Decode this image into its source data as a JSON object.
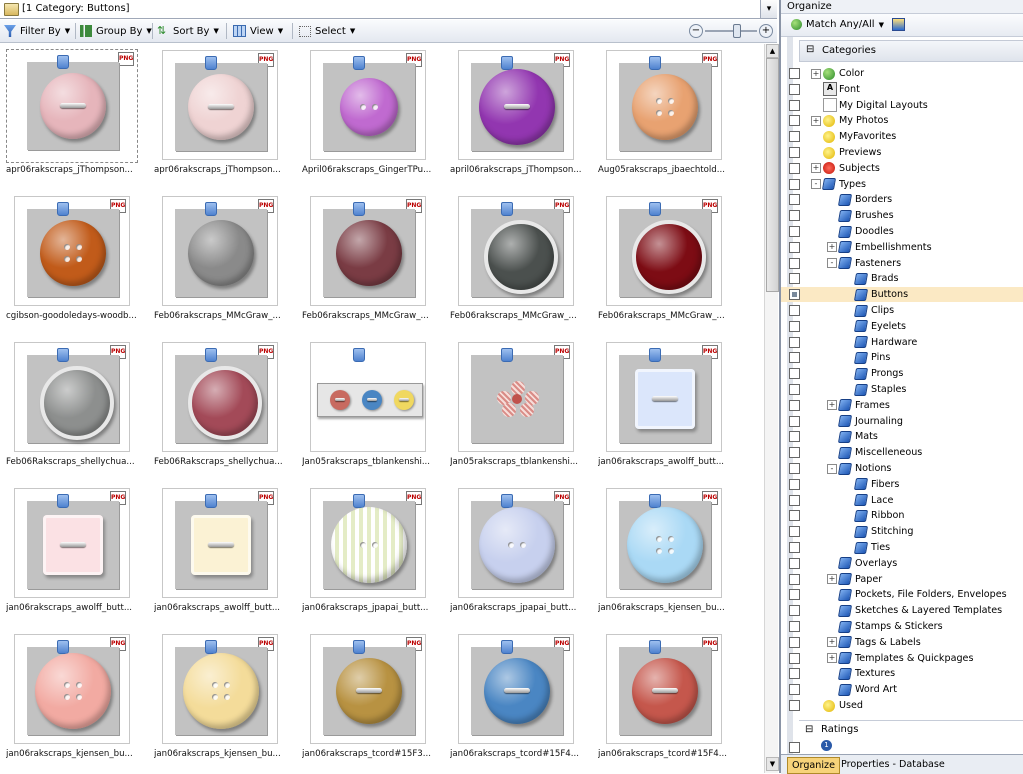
{
  "address": {
    "text": "[1 Category: Buttons]"
  },
  "toolbar": {
    "filter_by": "Filter By",
    "group_by": "Group By",
    "sort_by": "Sort By",
    "view": "View",
    "select": "Select"
  },
  "thumbnails": [
    {
      "caption": "apr06rakscraps_jThompson...",
      "kind": "round",
      "color": "#e6b5bb",
      "holes": "bar",
      "png": true,
      "selected": true
    },
    {
      "caption": "apr06rakscraps_jThompson...",
      "kind": "round",
      "color": "#efd3d3",
      "holes": "bar",
      "png": true
    },
    {
      "caption": "April06rakscraps_GingerTPu...",
      "kind": "round",
      "color": "#c06ad0",
      "holes": "two",
      "png": true,
      "small": true
    },
    {
      "caption": "april06rakscraps_jThompson...",
      "kind": "round",
      "color": "#9236b0",
      "holes": "bar",
      "png": true,
      "big": true
    },
    {
      "caption": "Aug05rakscraps_jbaechtold...",
      "kind": "round",
      "color": "#e8a271",
      "holes": "four",
      "png": true
    },
    {
      "caption": "cgibson-goodoledays-woodb...",
      "kind": "round",
      "color": "#c15b1a",
      "holes": "four",
      "png": true
    },
    {
      "caption": "Feb06rakscraps_MMcGraw_...",
      "kind": "round",
      "color": "#8a8a8a",
      "holes": "none",
      "png": true
    },
    {
      "caption": "Feb06rakscraps_MMcGraw_...",
      "kind": "round",
      "color": "#7a3c44",
      "holes": "none",
      "png": true
    },
    {
      "caption": "Feb06rakscraps_MMcGraw_...",
      "kind": "round",
      "color": "#4b504e",
      "holes": "none",
      "png": true,
      "ring": true
    },
    {
      "caption": "Feb06rakscraps_MMcGraw_...",
      "kind": "round",
      "color": "#7d0c14",
      "holes": "none",
      "png": true,
      "ring": true
    },
    {
      "caption": "Feb06Rakscraps_shellychua...",
      "kind": "round",
      "color": "#8d8f8e",
      "holes": "none",
      "png": true,
      "ring": true
    },
    {
      "caption": "Feb06Rakscraps_shellychua...",
      "kind": "round",
      "color": "#a34a58",
      "holes": "none",
      "png": true,
      "ring": true
    },
    {
      "caption": "Jan05rakscraps_tblankenshi...",
      "kind": "strip",
      "color": "#e8e8e8",
      "holes": "none",
      "png": false
    },
    {
      "caption": "Jan05rakscraps_tblankenshi...",
      "kind": "flower",
      "color": "#d98b86",
      "holes": "none",
      "png": true
    },
    {
      "caption": "jan06rakscraps_awolff_butt...",
      "kind": "square",
      "color": "#dbe6fb",
      "holes": "bar",
      "png": true
    },
    {
      "caption": "jan06rakscraps_awolff_butt...",
      "kind": "square",
      "color": "#fbe1e4",
      "holes": "bar",
      "png": true
    },
    {
      "caption": "jan06rakscraps_awolff_butt...",
      "kind": "square",
      "color": "#fbf2d4",
      "holes": "bar",
      "png": true
    },
    {
      "caption": "jan06rakscraps_jpapai_butt...",
      "kind": "round",
      "color": "#e4ecc6",
      "holes": "two",
      "png": true,
      "big": true,
      "stripes": true
    },
    {
      "caption": "jan06rakscraps_jpapai_butt...",
      "kind": "round",
      "color": "#c7d0ee",
      "holes": "two",
      "png": true,
      "big": true
    },
    {
      "caption": "jan06rakscraps_kjensen_bu...",
      "kind": "round",
      "color": "#aad9f5",
      "holes": "four",
      "png": true,
      "big": true
    },
    {
      "caption": "jan06rakscraps_kjensen_bu...",
      "kind": "round",
      "color": "#f2aaa2",
      "holes": "four",
      "png": true,
      "big": true
    },
    {
      "caption": "jan06rakscraps_kjensen_bu...",
      "kind": "round",
      "color": "#f4dc9a",
      "holes": "four",
      "png": true,
      "big": true
    },
    {
      "caption": "jan06rakscraps_tcord#15F3...",
      "kind": "round",
      "color": "#b89242",
      "holes": "bar",
      "png": true
    },
    {
      "caption": "jan06rakscraps_tcord#15F4...",
      "kind": "round",
      "color": "#4a86c3",
      "holes": "bar",
      "png": true
    },
    {
      "caption": "jan06rakscraps_tcord#15F4...",
      "kind": "round",
      "color": "#c5574c",
      "holes": "bar",
      "png": true
    }
  ],
  "panel": {
    "title": "Organize",
    "match": "Match Any/All",
    "categories_header": "Categories",
    "ratings_header": "Ratings",
    "tab_organize": "Organize",
    "tab_properties": "Properties - Database",
    "rating_value": "1"
  },
  "tree": [
    {
      "label": "Color",
      "level": 0,
      "exp": "+",
      "icon": "globe"
    },
    {
      "label": "Font",
      "level": 0,
      "exp": "",
      "icon": "font"
    },
    {
      "label": "My Digital Layouts",
      "level": 0,
      "exp": "",
      "icon": "doc"
    },
    {
      "label": "My Photos",
      "level": 0,
      "exp": "+",
      "icon": "smile"
    },
    {
      "label": "MyFavorites",
      "level": 0,
      "exp": "",
      "icon": "smile"
    },
    {
      "label": "Previews",
      "level": 0,
      "exp": "",
      "icon": "smile"
    },
    {
      "label": "Subjects",
      "level": 0,
      "exp": "+",
      "icon": "heart"
    },
    {
      "label": "Types",
      "level": 0,
      "exp": "-",
      "icon": "tag"
    },
    {
      "label": "Borders",
      "level": 1,
      "exp": "",
      "icon": "tag"
    },
    {
      "label": "Brushes",
      "level": 1,
      "exp": "",
      "icon": "tag"
    },
    {
      "label": "Doodles",
      "level": 1,
      "exp": "",
      "icon": "tag"
    },
    {
      "label": "Embellishments",
      "level": 1,
      "exp": "+",
      "icon": "tag"
    },
    {
      "label": "Fasteners",
      "level": 1,
      "exp": "-",
      "icon": "tag"
    },
    {
      "label": "Brads",
      "level": 2,
      "exp": "",
      "icon": "tag"
    },
    {
      "label": "Buttons",
      "level": 2,
      "exp": "",
      "icon": "tag",
      "highlight": true
    },
    {
      "label": "Clips",
      "level": 2,
      "exp": "",
      "icon": "tag"
    },
    {
      "label": "Eyelets",
      "level": 2,
      "exp": "",
      "icon": "tag"
    },
    {
      "label": "Hardware",
      "level": 2,
      "exp": "",
      "icon": "tag"
    },
    {
      "label": "Pins",
      "level": 2,
      "exp": "",
      "icon": "tag"
    },
    {
      "label": "Prongs",
      "level": 2,
      "exp": "",
      "icon": "tag"
    },
    {
      "label": "Staples",
      "level": 2,
      "exp": "",
      "icon": "tag"
    },
    {
      "label": "Frames",
      "level": 1,
      "exp": "+",
      "icon": "tag"
    },
    {
      "label": "Journaling",
      "level": 1,
      "exp": "",
      "icon": "tag"
    },
    {
      "label": "Mats",
      "level": 1,
      "exp": "",
      "icon": "tag"
    },
    {
      "label": "Miscelleneous",
      "level": 1,
      "exp": "",
      "icon": "tag"
    },
    {
      "label": "Notions",
      "level": 1,
      "exp": "-",
      "icon": "tag"
    },
    {
      "label": "Fibers",
      "level": 2,
      "exp": "",
      "icon": "tag"
    },
    {
      "label": "Lace",
      "level": 2,
      "exp": "",
      "icon": "tag"
    },
    {
      "label": "Ribbon",
      "level": 2,
      "exp": "",
      "icon": "tag"
    },
    {
      "label": "Stitching",
      "level": 2,
      "exp": "",
      "icon": "tag"
    },
    {
      "label": "Ties",
      "level": 2,
      "exp": "",
      "icon": "tag"
    },
    {
      "label": "Overlays",
      "level": 1,
      "exp": "",
      "icon": "tag"
    },
    {
      "label": "Paper",
      "level": 1,
      "exp": "+",
      "icon": "tag"
    },
    {
      "label": "Pockets, File Folders, Envelopes",
      "level": 1,
      "exp": "",
      "icon": "tag"
    },
    {
      "label": "Sketches & Layered Templates",
      "level": 1,
      "exp": "",
      "icon": "tag"
    },
    {
      "label": "Stamps & Stickers",
      "level": 1,
      "exp": "",
      "icon": "tag"
    },
    {
      "label": "Tags & Labels",
      "level": 1,
      "exp": "+",
      "icon": "tag"
    },
    {
      "label": "Templates & Quickpages",
      "level": 1,
      "exp": "+",
      "icon": "tag"
    },
    {
      "label": "Textures",
      "level": 1,
      "exp": "",
      "icon": "tag"
    },
    {
      "label": "Word Art",
      "level": 1,
      "exp": "",
      "icon": "tag"
    },
    {
      "label": "Used",
      "level": 0,
      "exp": "",
      "icon": "smile"
    }
  ]
}
